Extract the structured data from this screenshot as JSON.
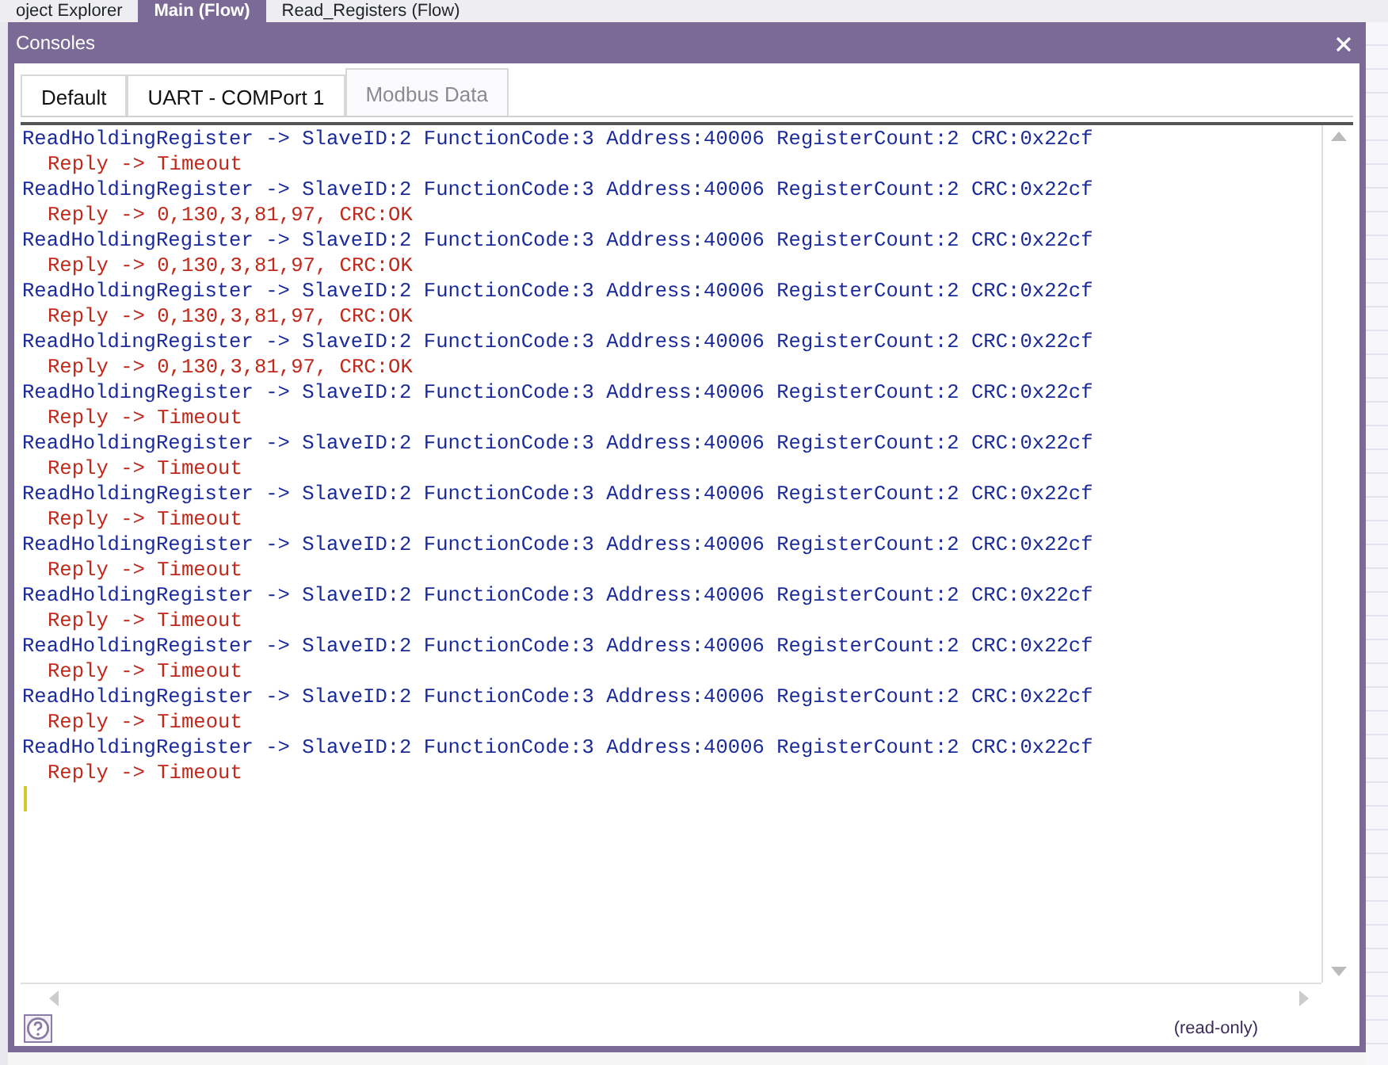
{
  "background_tabs": [
    {
      "label": "oject Explorer",
      "selected": false
    },
    {
      "label": "Main (Flow)",
      "selected": true
    },
    {
      "label": "Read_Registers (Flow)",
      "selected": false
    }
  ],
  "window": {
    "title": "Consoles"
  },
  "tabs": [
    {
      "label": "Default",
      "selected": false
    },
    {
      "label": "UART - COMPort 1",
      "selected": false
    },
    {
      "label": "Modbus Data",
      "selected": true
    }
  ],
  "console_lines": [
    {
      "kind": "request",
      "text": "ReadHoldingRegister -> SlaveID:2 FunctionCode:3 Address:40006 RegisterCount:2 CRC:0x22cf"
    },
    {
      "kind": "reply",
      "text": "Reply -> Timeout"
    },
    {
      "kind": "request",
      "text": "ReadHoldingRegister -> SlaveID:2 FunctionCode:3 Address:40006 RegisterCount:2 CRC:0x22cf"
    },
    {
      "kind": "reply",
      "text": "Reply -> 0,130,3,81,97, CRC:OK"
    },
    {
      "kind": "request",
      "text": "ReadHoldingRegister -> SlaveID:2 FunctionCode:3 Address:40006 RegisterCount:2 CRC:0x22cf"
    },
    {
      "kind": "reply",
      "text": "Reply -> 0,130,3,81,97, CRC:OK"
    },
    {
      "kind": "request",
      "text": "ReadHoldingRegister -> SlaveID:2 FunctionCode:3 Address:40006 RegisterCount:2 CRC:0x22cf"
    },
    {
      "kind": "reply",
      "text": "Reply -> 0,130,3,81,97, CRC:OK"
    },
    {
      "kind": "request",
      "text": "ReadHoldingRegister -> SlaveID:2 FunctionCode:3 Address:40006 RegisterCount:2 CRC:0x22cf"
    },
    {
      "kind": "reply",
      "text": "Reply -> 0,130,3,81,97, CRC:OK"
    },
    {
      "kind": "request",
      "text": "ReadHoldingRegister -> SlaveID:2 FunctionCode:3 Address:40006 RegisterCount:2 CRC:0x22cf"
    },
    {
      "kind": "reply",
      "text": "Reply -> Timeout"
    },
    {
      "kind": "request",
      "text": "ReadHoldingRegister -> SlaveID:2 FunctionCode:3 Address:40006 RegisterCount:2 CRC:0x22cf"
    },
    {
      "kind": "reply",
      "text": "Reply -> Timeout"
    },
    {
      "kind": "request",
      "text": "ReadHoldingRegister -> SlaveID:2 FunctionCode:3 Address:40006 RegisterCount:2 CRC:0x22cf"
    },
    {
      "kind": "reply",
      "text": "Reply -> Timeout"
    },
    {
      "kind": "request",
      "text": "ReadHoldingRegister -> SlaveID:2 FunctionCode:3 Address:40006 RegisterCount:2 CRC:0x22cf"
    },
    {
      "kind": "reply",
      "text": "Reply -> Timeout"
    },
    {
      "kind": "request",
      "text": "ReadHoldingRegister -> SlaveID:2 FunctionCode:3 Address:40006 RegisterCount:2 CRC:0x22cf"
    },
    {
      "kind": "reply",
      "text": "Reply -> Timeout"
    },
    {
      "kind": "request",
      "text": "ReadHoldingRegister -> SlaveID:2 FunctionCode:3 Address:40006 RegisterCount:2 CRC:0x22cf"
    },
    {
      "kind": "reply",
      "text": "Reply -> Timeout"
    },
    {
      "kind": "request",
      "text": "ReadHoldingRegister -> SlaveID:2 FunctionCode:3 Address:40006 RegisterCount:2 CRC:0x22cf"
    },
    {
      "kind": "reply",
      "text": "Reply -> Timeout"
    },
    {
      "kind": "request",
      "text": "ReadHoldingRegister -> SlaveID:2 FunctionCode:3 Address:40006 RegisterCount:2 CRC:0x22cf"
    },
    {
      "kind": "reply",
      "text": "Reply -> Timeout"
    }
  ],
  "status": "(read-only)"
}
